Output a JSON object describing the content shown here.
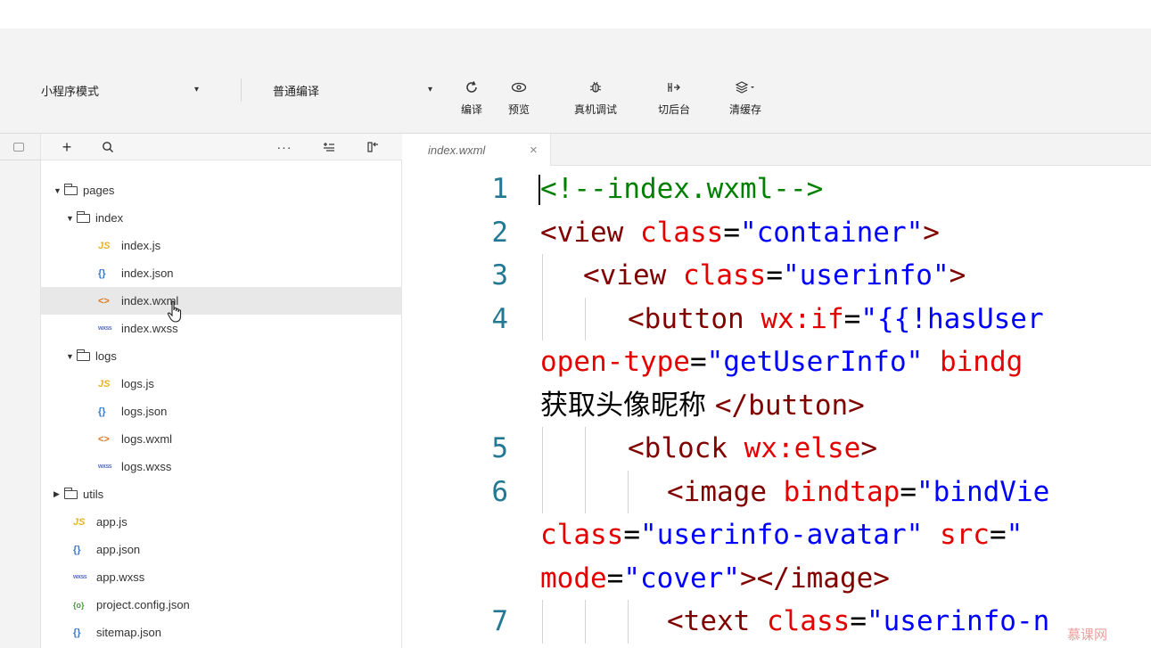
{
  "toolbar": {
    "mode_select": "小程序模式",
    "compile_select": "普通编译",
    "buttons": {
      "compile": "编译",
      "preview": "预览",
      "remote_debug": "真机调试",
      "background": "切后台",
      "clear_cache": "清缓存"
    }
  },
  "explorer": {
    "tree": [
      {
        "type": "folder",
        "label": "pages",
        "expanded": true
      },
      {
        "type": "folder",
        "label": "index",
        "expanded": true
      },
      {
        "type": "file",
        "icon": "JS",
        "label": "index.js"
      },
      {
        "type": "file",
        "icon": "{}",
        "label": "index.json"
      },
      {
        "type": "file",
        "icon": "<>",
        "label": "index.wxml",
        "selected": true
      },
      {
        "type": "file",
        "icon": "wxss",
        "label": "index.wxss"
      },
      {
        "type": "folder",
        "label": "logs",
        "expanded": true
      },
      {
        "type": "file",
        "icon": "JS",
        "label": "logs.js"
      },
      {
        "type": "file",
        "icon": "{}",
        "label": "logs.json"
      },
      {
        "type": "file",
        "icon": "<>",
        "label": "logs.wxml"
      },
      {
        "type": "file",
        "icon": "wxss",
        "label": "logs.wxss"
      },
      {
        "type": "folder",
        "label": "utils",
        "expanded": false
      },
      {
        "type": "file",
        "icon": "JS",
        "label": "app.js"
      },
      {
        "type": "file",
        "icon": "{}",
        "label": "app.json"
      },
      {
        "type": "file",
        "icon": "wxss",
        "label": "app.wxss"
      },
      {
        "type": "file",
        "icon": "{o}",
        "label": "project.config.json"
      },
      {
        "type": "file",
        "icon": "{}",
        "label": "sitemap.json"
      }
    ]
  },
  "editor": {
    "tab_title": "index.wxml",
    "tab_close": "×",
    "line_numbers": [
      "1",
      "2",
      "3",
      "4",
      "5",
      "6",
      "7"
    ],
    "code": {
      "l1_comment": "<!--index.wxml-->",
      "l2_open": "<view ",
      "l2_attr": "class",
      "l2_eq": "=",
      "l2_val": "\"container\"",
      "l2_close": ">",
      "l3_open": "<view ",
      "l3_attr": "class",
      "l3_eq": "=",
      "l3_val": "\"userinfo\"",
      "l3_close": ">",
      "l4_open": "<button ",
      "l4_attr": "wx:if",
      "l4_eq": "=",
      "l4_val": "\"{{!hasUser",
      "l4b_attr": "open-type",
      "l4b_eq": "=",
      "l4b_val": "\"getUserInfo\"",
      "l4b_attr2": " bindg",
      "l4c_text": "获取头像昵称 ",
      "l4c_close": "</button>",
      "l5_open": "<block ",
      "l5_attr": "wx:else",
      "l5_close": ">",
      "l6_open": "<image ",
      "l6_attr": "bindtap",
      "l6_eq": "=",
      "l6_val": "\"bindVie",
      "l6b_attr": "class",
      "l6b_eq": "=",
      "l6b_val": "\"userinfo-avatar\"",
      "l6b_attr2": " src",
      "l6b_eq2": "=",
      "l6b_val2": "\"",
      "l6c_attr": "mode",
      "l6c_eq": "=",
      "l6c_val": "\"cover\"",
      "l6c_close": "></image>",
      "l7_open": "<text ",
      "l7_attr": "class",
      "l7_eq": "=",
      "l7_val": "\"userinfo-n"
    }
  },
  "watermark": "慕课网",
  "colors": {
    "comment": "#008000",
    "tag": "#800000",
    "attribute": "#e50000",
    "string": "#0000ff",
    "line_number": "#237893"
  }
}
